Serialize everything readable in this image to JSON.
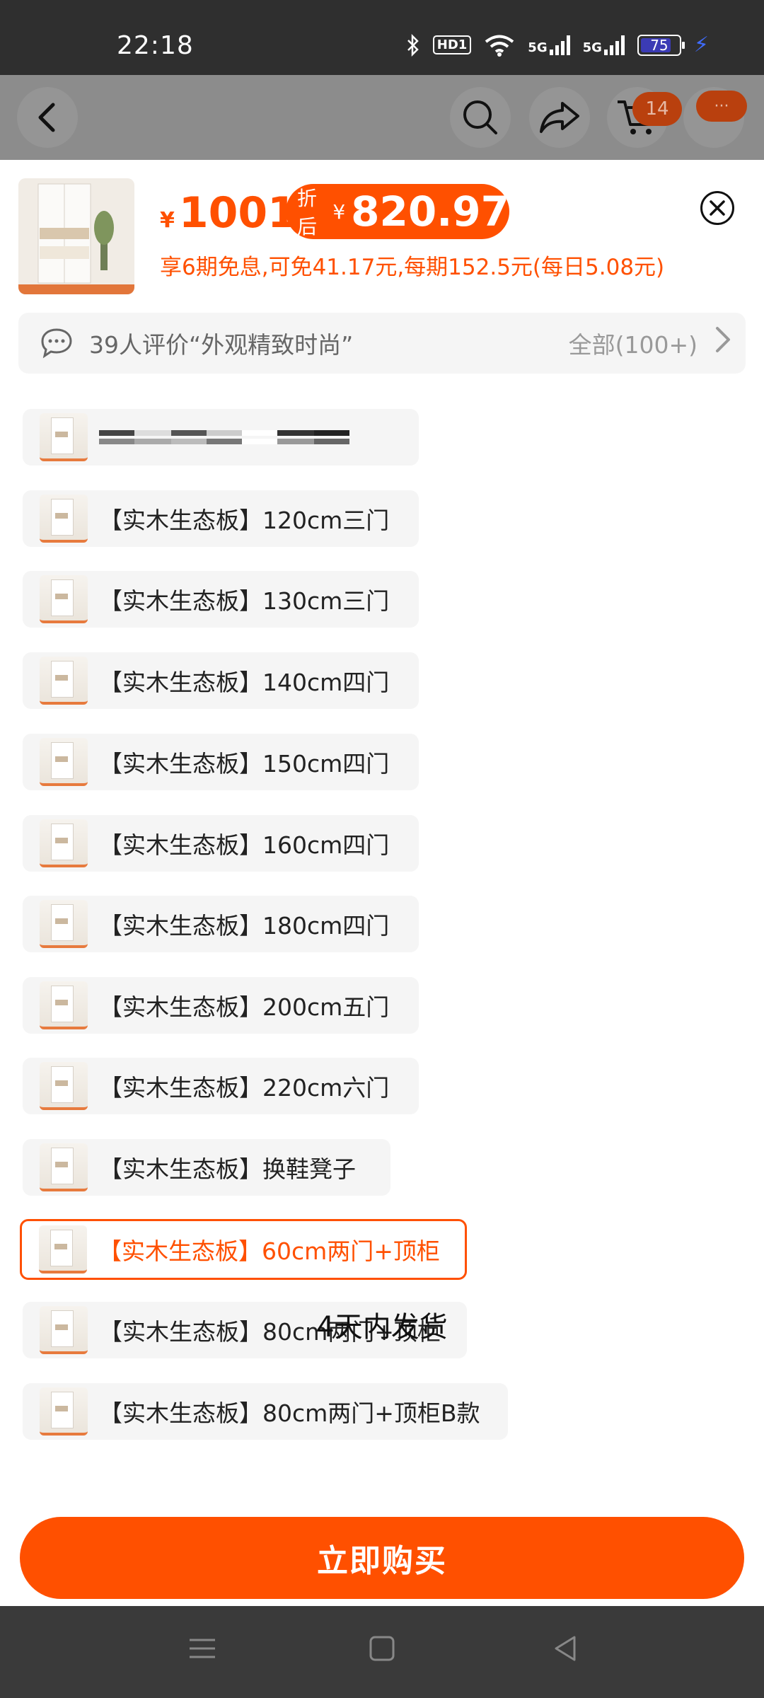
{
  "status_bar": {
    "time": "22:18",
    "icons": [
      "bluetooth-icon",
      "hd-icon",
      "wifi-icon",
      "5g-signal-icon",
      "5g-signal-icon",
      "battery-icon",
      "charging-icon"
    ],
    "hd_label": "HD1",
    "network_1": "5G",
    "network_2": "5G",
    "battery": "75"
  },
  "header": {
    "cart_count": "14",
    "more_label": "···"
  },
  "product": {
    "currency": "¥",
    "price": "1001",
    "discount_label": "折后",
    "discount_price": "820.97",
    "installment_text": "享6期免息,可免41.17元,每期152.5元(每日5.08元)"
  },
  "review": {
    "text": "39人评价“外观精致时尚”",
    "all_label": "全部(100+)"
  },
  "options": [
    {
      "label": "",
      "redacted": true,
      "selected": false
    },
    {
      "label": "【实木生态板】120cm三门",
      "selected": false
    },
    {
      "label": "【实木生态板】130cm三门",
      "selected": false
    },
    {
      "label": "【实木生态板】140cm四门",
      "selected": false
    },
    {
      "label": "【实木生态板】150cm四门",
      "selected": false
    },
    {
      "label": "【实木生态板】160cm四门",
      "selected": false
    },
    {
      "label": "【实木生态板】180cm四门",
      "selected": false
    },
    {
      "label": "【实木生态板】200cm五门",
      "selected": false
    },
    {
      "label": "【实木生态板】220cm六门",
      "selected": false
    },
    {
      "label": "【实木生态板】换鞋凳子",
      "selected": false
    },
    {
      "label": "【实木生态板】60cm两门+顶柜",
      "selected": true
    },
    {
      "label": "【实木生态板】80cm两门+顶柜",
      "selected": false
    },
    {
      "label": "【实木生态板】80cm两门+顶柜B款",
      "selected": false
    }
  ],
  "shipping": "4天内发货",
  "buy_button": "立即购买",
  "colors": {
    "accent": "#ff5000",
    "option_bg": "#f5f5f5",
    "status_bar": "#2f2f2f"
  }
}
